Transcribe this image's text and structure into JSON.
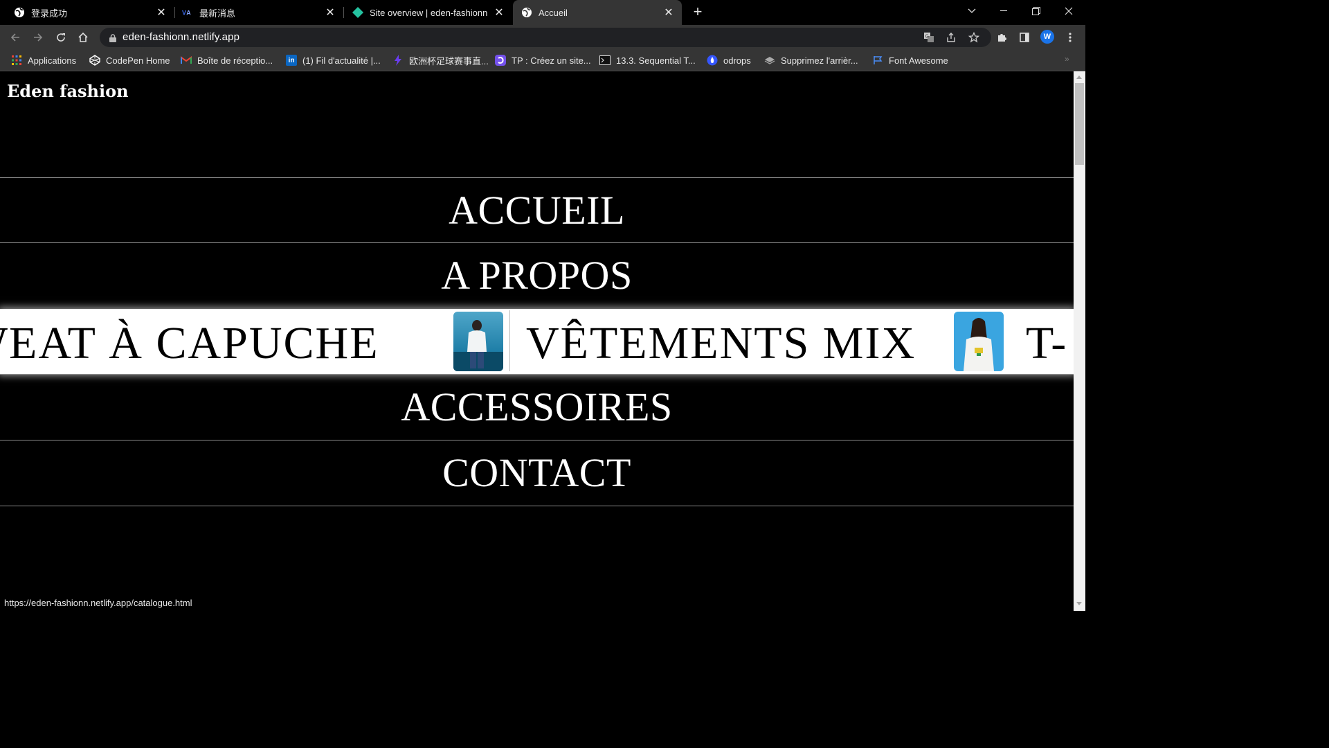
{
  "browser": {
    "tabs": [
      {
        "title": "登录成功",
        "icon": "globe-icon"
      },
      {
        "title": "最新消息",
        "icon": "wa-icon"
      },
      {
        "title": "Site overview | eden-fashionn",
        "icon": "netlify-icon"
      },
      {
        "title": "Accueil",
        "icon": "globe-icon",
        "active": true
      }
    ],
    "url": "eden-fashionn.netlify.app",
    "profile_initial": "W",
    "bookmarks": [
      {
        "label": "Applications",
        "icon": "apps-grid-icon"
      },
      {
        "label": "CodePen Home",
        "icon": "codepen-icon"
      },
      {
        "label": "Boîte de réceptio...",
        "icon": "gmail-icon"
      },
      {
        "label": "(1) Fil d'actualité |...",
        "icon": "linkedin-icon"
      },
      {
        "label": "欧洲杯足球赛事直...",
        "icon": "bolt-icon"
      },
      {
        "label": "TP : Créez un site...",
        "icon": "openclassrooms-icon"
      },
      {
        "label": "13.3. Sequential T...",
        "icon": "terminal-icon"
      },
      {
        "label": "odrops",
        "icon": "drop-icon"
      },
      {
        "label": "Supprimez l'arrièr...",
        "icon": "layers-icon"
      },
      {
        "label": "Font Awesome",
        "icon": "flag-icon"
      }
    ]
  },
  "site": {
    "brand": "Eden fashion",
    "menu": [
      "ACCUEIL",
      "A PROPOS",
      "ACCESSOIRES",
      "CONTACT"
    ],
    "marquee": {
      "items": [
        "SWEAT À CAPUCHE",
        "VÊTEMENTS MIX",
        "T-"
      ]
    }
  },
  "status_url": "https://eden-fashionn.netlify.app/catalogue.html"
}
